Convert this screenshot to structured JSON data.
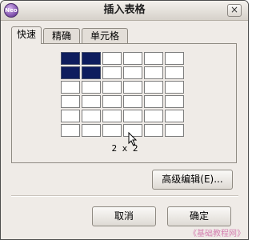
{
  "window": {
    "title": "插入表格",
    "close_label": "×",
    "app_icon_label": "Neo"
  },
  "tabs": [
    {
      "label": "快速",
      "active": true
    },
    {
      "label": "精确",
      "active": false
    },
    {
      "label": "单元格",
      "active": false
    }
  ],
  "grid_picker": {
    "columns": 6,
    "rows": 6,
    "selected_columns": 2,
    "selected_rows": 2,
    "size_label": "2 x 2",
    "selected_color": "#0e1d5e"
  },
  "buttons": {
    "advanced_label": "高级编辑(E)...",
    "cancel_label": "取消",
    "ok_label": "确定"
  },
  "icons": {
    "app": "app-logo-icon",
    "close": "close-icon",
    "cursor": "mouse-pointer-icon"
  },
  "watermark": "《基础教程网》"
}
